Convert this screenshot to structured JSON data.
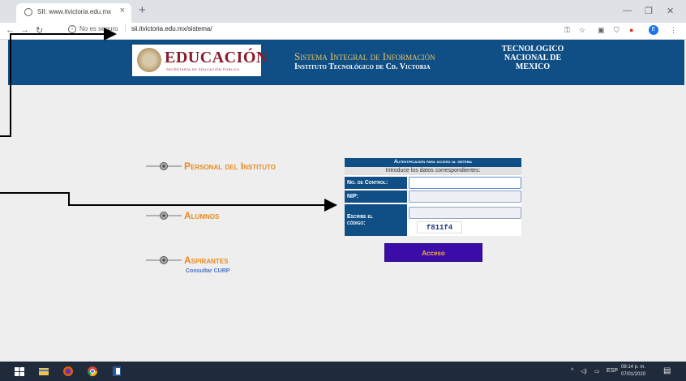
{
  "browser": {
    "tab_title": "SII: www.itvictoria.edu.mx",
    "tab_close": "×",
    "new_tab": "+",
    "not_secure": "No es seguro",
    "url": "sii.itvictoria.edu.mx/sistema/",
    "profile_initial": "E"
  },
  "header": {
    "logo_text": "EDUCACIÓN",
    "logo_subtext": "SECRETARÍA DE EDUCACIÓN PÚBLICA",
    "title": "Sistema Integral de Información",
    "subtitle": "Instituto Tecnológico de Cd. Victoria",
    "tecnm_line1": "TECNOLOGICO",
    "tecnm_line2": "NACIONAL DE",
    "tecnm_line3": "MEXICO"
  },
  "menu": {
    "personal": "Personal del Instituto",
    "alumnos": "Alumnos",
    "aspirantes": "Aspirantes",
    "consultar_curp": "Consultar CURP"
  },
  "login": {
    "header": "Autentificación para acceso al sistema",
    "intro": "Introduce los datos correspondientes:",
    "control_label": "No. de Control:",
    "nip_label": "NIP:",
    "code_label_1": "Escribe el",
    "code_label_2": "código:",
    "captcha": "f811f4",
    "submit": "Acceso"
  },
  "taskbar": {
    "lang": "ESP",
    "time": "08:14 p. m.",
    "date": "07/01/2020"
  }
}
